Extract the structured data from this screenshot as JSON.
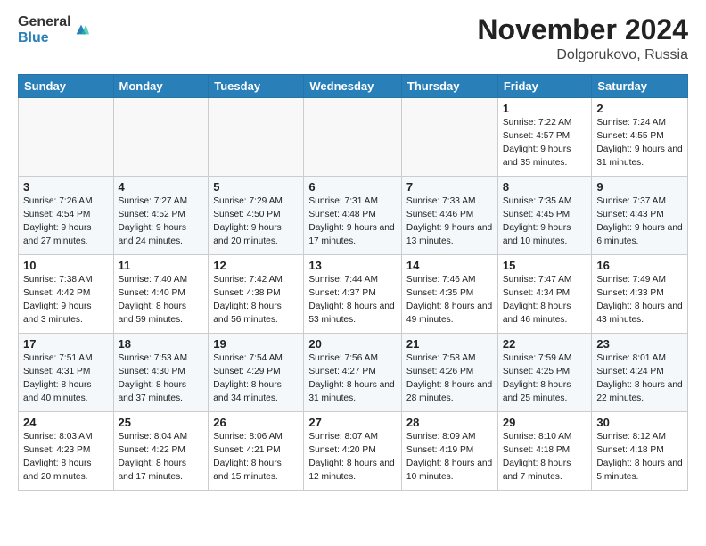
{
  "header": {
    "logo_general": "General",
    "logo_blue": "Blue",
    "month_title": "November 2024",
    "location": "Dolgorukovo, Russia"
  },
  "weekdays": [
    "Sunday",
    "Monday",
    "Tuesday",
    "Wednesday",
    "Thursday",
    "Friday",
    "Saturday"
  ],
  "weeks": [
    [
      {
        "day": "",
        "info": ""
      },
      {
        "day": "",
        "info": ""
      },
      {
        "day": "",
        "info": ""
      },
      {
        "day": "",
        "info": ""
      },
      {
        "day": "",
        "info": ""
      },
      {
        "day": "1",
        "info": "Sunrise: 7:22 AM\nSunset: 4:57 PM\nDaylight: 9 hours\nand 35 minutes."
      },
      {
        "day": "2",
        "info": "Sunrise: 7:24 AM\nSunset: 4:55 PM\nDaylight: 9 hours\nand 31 minutes."
      }
    ],
    [
      {
        "day": "3",
        "info": "Sunrise: 7:26 AM\nSunset: 4:54 PM\nDaylight: 9 hours\nand 27 minutes."
      },
      {
        "day": "4",
        "info": "Sunrise: 7:27 AM\nSunset: 4:52 PM\nDaylight: 9 hours\nand 24 minutes."
      },
      {
        "day": "5",
        "info": "Sunrise: 7:29 AM\nSunset: 4:50 PM\nDaylight: 9 hours\nand 20 minutes."
      },
      {
        "day": "6",
        "info": "Sunrise: 7:31 AM\nSunset: 4:48 PM\nDaylight: 9 hours\nand 17 minutes."
      },
      {
        "day": "7",
        "info": "Sunrise: 7:33 AM\nSunset: 4:46 PM\nDaylight: 9 hours\nand 13 minutes."
      },
      {
        "day": "8",
        "info": "Sunrise: 7:35 AM\nSunset: 4:45 PM\nDaylight: 9 hours\nand 10 minutes."
      },
      {
        "day": "9",
        "info": "Sunrise: 7:37 AM\nSunset: 4:43 PM\nDaylight: 9 hours\nand 6 minutes."
      }
    ],
    [
      {
        "day": "10",
        "info": "Sunrise: 7:38 AM\nSunset: 4:42 PM\nDaylight: 9 hours\nand 3 minutes."
      },
      {
        "day": "11",
        "info": "Sunrise: 7:40 AM\nSunset: 4:40 PM\nDaylight: 8 hours\nand 59 minutes."
      },
      {
        "day": "12",
        "info": "Sunrise: 7:42 AM\nSunset: 4:38 PM\nDaylight: 8 hours\nand 56 minutes."
      },
      {
        "day": "13",
        "info": "Sunrise: 7:44 AM\nSunset: 4:37 PM\nDaylight: 8 hours\nand 53 minutes."
      },
      {
        "day": "14",
        "info": "Sunrise: 7:46 AM\nSunset: 4:35 PM\nDaylight: 8 hours\nand 49 minutes."
      },
      {
        "day": "15",
        "info": "Sunrise: 7:47 AM\nSunset: 4:34 PM\nDaylight: 8 hours\nand 46 minutes."
      },
      {
        "day": "16",
        "info": "Sunrise: 7:49 AM\nSunset: 4:33 PM\nDaylight: 8 hours\nand 43 minutes."
      }
    ],
    [
      {
        "day": "17",
        "info": "Sunrise: 7:51 AM\nSunset: 4:31 PM\nDaylight: 8 hours\nand 40 minutes."
      },
      {
        "day": "18",
        "info": "Sunrise: 7:53 AM\nSunset: 4:30 PM\nDaylight: 8 hours\nand 37 minutes."
      },
      {
        "day": "19",
        "info": "Sunrise: 7:54 AM\nSunset: 4:29 PM\nDaylight: 8 hours\nand 34 minutes."
      },
      {
        "day": "20",
        "info": "Sunrise: 7:56 AM\nSunset: 4:27 PM\nDaylight: 8 hours\nand 31 minutes."
      },
      {
        "day": "21",
        "info": "Sunrise: 7:58 AM\nSunset: 4:26 PM\nDaylight: 8 hours\nand 28 minutes."
      },
      {
        "day": "22",
        "info": "Sunrise: 7:59 AM\nSunset: 4:25 PM\nDaylight: 8 hours\nand 25 minutes."
      },
      {
        "day": "23",
        "info": "Sunrise: 8:01 AM\nSunset: 4:24 PM\nDaylight: 8 hours\nand 22 minutes."
      }
    ],
    [
      {
        "day": "24",
        "info": "Sunrise: 8:03 AM\nSunset: 4:23 PM\nDaylight: 8 hours\nand 20 minutes."
      },
      {
        "day": "25",
        "info": "Sunrise: 8:04 AM\nSunset: 4:22 PM\nDaylight: 8 hours\nand 17 minutes."
      },
      {
        "day": "26",
        "info": "Sunrise: 8:06 AM\nSunset: 4:21 PM\nDaylight: 8 hours\nand 15 minutes."
      },
      {
        "day": "27",
        "info": "Sunrise: 8:07 AM\nSunset: 4:20 PM\nDaylight: 8 hours\nand 12 minutes."
      },
      {
        "day": "28",
        "info": "Sunrise: 8:09 AM\nSunset: 4:19 PM\nDaylight: 8 hours\nand 10 minutes."
      },
      {
        "day": "29",
        "info": "Sunrise: 8:10 AM\nSunset: 4:18 PM\nDaylight: 8 hours\nand 7 minutes."
      },
      {
        "day": "30",
        "info": "Sunrise: 8:12 AM\nSunset: 4:18 PM\nDaylight: 8 hours\nand 5 minutes."
      }
    ]
  ]
}
